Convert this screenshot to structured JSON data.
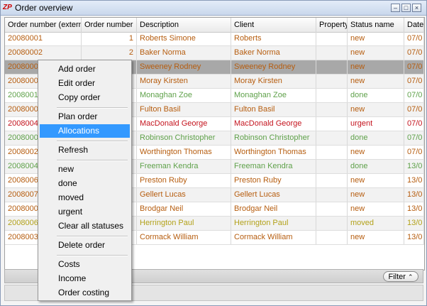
{
  "window": {
    "title": "Order overview",
    "logo": "ZP"
  },
  "columns": [
    {
      "label": "Order number (extern",
      "w": 108
    },
    {
      "label": "Order number",
      "w": 78
    },
    {
      "label": "Description",
      "w": 133
    },
    {
      "label": "Client",
      "w": 120
    },
    {
      "label": "Property",
      "w": 44
    },
    {
      "label": "Status name",
      "w": 80
    },
    {
      "label": "Date",
      "w": 28
    }
  ],
  "rows": [
    {
      "ext": "20080001",
      "num": "1",
      "desc": "Roberts Simone",
      "client": "Roberts",
      "prop": "",
      "status": "new",
      "date": "07/0",
      "color": "#b65d0f"
    },
    {
      "ext": "20080002",
      "num": "2",
      "desc": "Baker Norma",
      "client": "Baker Norma",
      "prop": "",
      "status": "new",
      "date": "07/0",
      "color": "#b65d0f"
    },
    {
      "ext": "2008000",
      "num": "",
      "desc": "Sweeney Rodney",
      "client": "Sweeney Rodney",
      "prop": "",
      "status": "new",
      "date": "07/0",
      "color": "#b65d0f"
    },
    {
      "ext": "2008000",
      "num": "",
      "desc": "Moray Kirsten",
      "client": "Moray Kirsten",
      "prop": "",
      "status": "new",
      "date": "07/0",
      "color": "#b65d0f"
    },
    {
      "ext": "2008001",
      "num": "",
      "desc": "Monaghan Zoe",
      "client": "Monaghan Zoe",
      "prop": "",
      "status": "done",
      "date": "07/0",
      "color": "#5fa14a"
    },
    {
      "ext": "2008000",
      "num": "",
      "desc": "Fulton Basil",
      "client": "Fulton Basil",
      "prop": "",
      "status": "new",
      "date": "07/0",
      "color": "#b65d0f"
    },
    {
      "ext": "2008004",
      "num": "",
      "desc": "MacDonald George",
      "client": "MacDonald George",
      "prop": "",
      "status": "urgent",
      "date": "07/0",
      "color": "#c4141e"
    },
    {
      "ext": "2008000",
      "num": "",
      "desc": "Robinson Christopher",
      "client": "Robinson Christopher",
      "prop": "",
      "status": "done",
      "date": "07/0",
      "color": "#5fa14a"
    },
    {
      "ext": "2008002",
      "num": "",
      "desc": "Worthington Thomas",
      "client": "Worthington Thomas",
      "prop": "",
      "status": "new",
      "date": "07/0",
      "color": "#b65d0f"
    },
    {
      "ext": "2008004",
      "num": "",
      "desc": "Freeman Kendra",
      "client": "Freeman Kendra",
      "prop": "",
      "status": "done",
      "date": "13/0",
      "color": "#5fa14a"
    },
    {
      "ext": "2008006",
      "num": "",
      "desc": "Preston Ruby",
      "client": "Preston Ruby",
      "prop": "",
      "status": "new",
      "date": "13/0",
      "color": "#b65d0f"
    },
    {
      "ext": "2008007",
      "num": "",
      "desc": "Gellert Lucas",
      "client": "Gellert Lucas",
      "prop": "",
      "status": "new",
      "date": "13/0",
      "color": "#b65d0f"
    },
    {
      "ext": "2008000",
      "num": "",
      "desc": "Brodgar Neil",
      "client": "Brodgar Neil",
      "prop": "",
      "status": "new",
      "date": "13/0",
      "color": "#b65d0f"
    },
    {
      "ext": "2008006",
      "num": "",
      "desc": "Herrington Paul",
      "client": "Herrington Paul",
      "prop": "",
      "status": "moved",
      "date": "13/0",
      "color": "#b3a21a"
    },
    {
      "ext": "2008003",
      "num": "",
      "desc": "Cormack William",
      "client": "Cormack William",
      "prop": "",
      "status": "new",
      "date": "13/0",
      "color": "#b65d0f"
    }
  ],
  "selected_row": 2,
  "filter_label": "Filter",
  "context_menu": {
    "groups": [
      [
        "Add order",
        "Edit order",
        "Copy order"
      ],
      [
        "Plan order",
        "Allocations"
      ],
      [
        "Refresh"
      ],
      [
        "new",
        "done",
        "moved",
        "urgent",
        "Clear all statuses"
      ],
      [
        "Delete order"
      ],
      [
        "Costs",
        "Income",
        "Order costing"
      ]
    ],
    "active": "Allocations"
  },
  "colors": {
    "selected_row": "#a8a8a8",
    "menu_highlight": "#3399ff"
  }
}
